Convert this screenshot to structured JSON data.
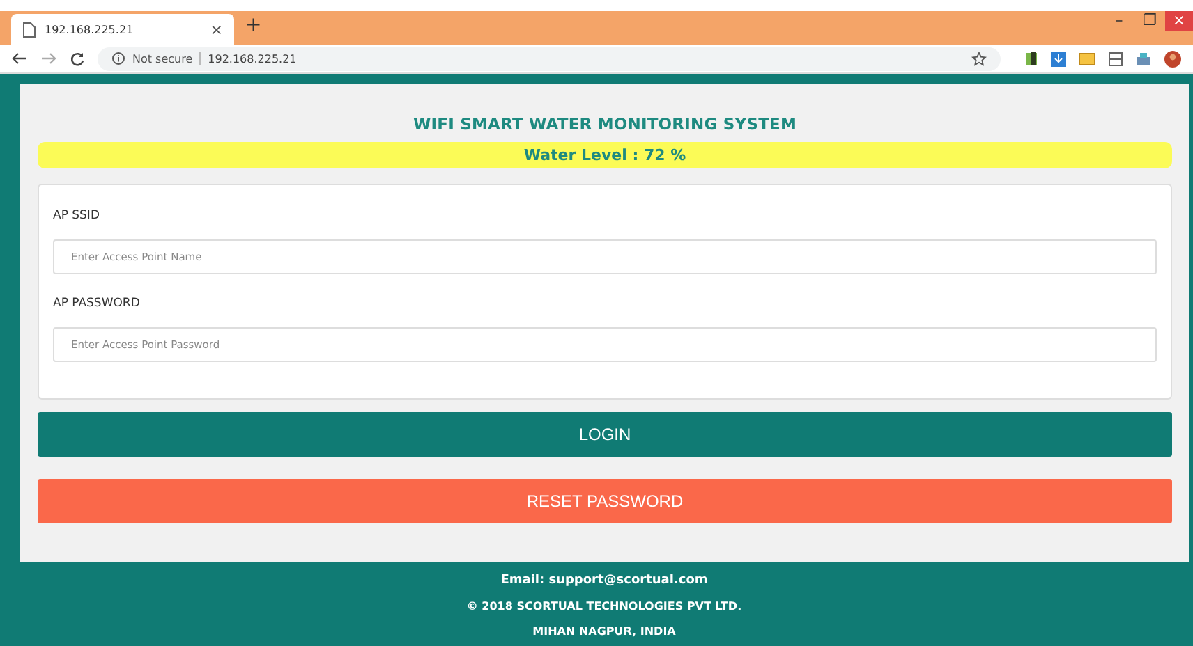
{
  "browser": {
    "tab": {
      "title": "192.168.225.21",
      "close": "×"
    },
    "new_tab": "+",
    "window_controls": {
      "minimize": "–",
      "maximize": "❐",
      "close": "×"
    },
    "security": "Not secure",
    "url": "192.168.225.21"
  },
  "page": {
    "title": "WIFI SMART WATER MONITORING SYSTEM",
    "water_level": "Water Level : 72 %",
    "fields": [
      {
        "label": "AP SSID",
        "placeholder": "Enter Access Point Name"
      },
      {
        "label": "AP PASSWORD",
        "placeholder": "Enter Access Point Password"
      }
    ],
    "buttons": [
      {
        "label": "LOGIN",
        "kind": "primary"
      },
      {
        "label": "RESET PASSWORD",
        "kind": "danger"
      }
    ]
  },
  "footer": {
    "lines": [
      "Email: support@scortual.com",
      "© 2018 SCORTUAL TECHNOLOGIES PVT LTD.",
      "MIHAN NAGPUR, INDIA"
    ]
  }
}
